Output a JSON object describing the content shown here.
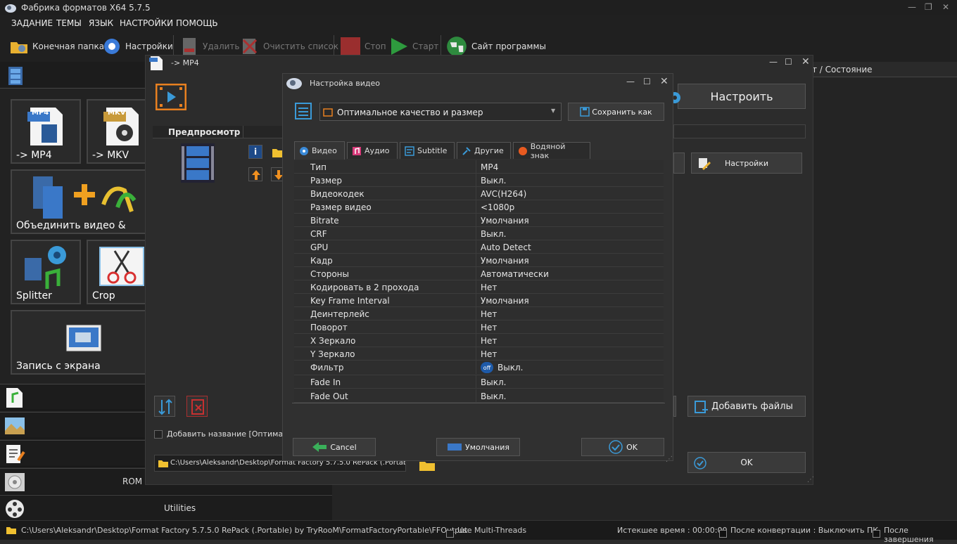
{
  "app": {
    "title": "Фабрика форматов X64 5.7.5"
  },
  "menu": [
    "ЗАДАНИЕ",
    "ТЕМЫ",
    "ЯЗЫК",
    "НАСТРОЙКИ",
    "ПОМОЩЬ"
  ],
  "toolbar": {
    "output_folder": "Конечная папка",
    "settings": "Настройки",
    "delete": "Удалить",
    "clear_list": "Очистить список",
    "stop": "Стоп",
    "start": "Старт",
    "website": "Сайт программы"
  },
  "left": {
    "tiles": {
      "mp4": "-> MP4",
      "mp4_badge": "MP4",
      "mkv": "-> MKV",
      "mkv_badge": "MKV",
      "join": "Объединить видео &",
      "splitter": "Splitter",
      "crop": "Crop",
      "record": "Запись с экрана"
    },
    "categories": {
      "rom": "ROM",
      "utilities": "Utilities"
    }
  },
  "main": {
    "status_col": "т / Состояние"
  },
  "convwin": {
    "title": "-> MP4",
    "preview": "Предпросмотр",
    "configure": "Настроить",
    "settings_btn": "Настройки",
    "add_files": "Добавить файлы",
    "add_name": "Добавить название [Оптимальное",
    "path": "C:\\Users\\Aleksandr\\Desktop\\Format Factory 5.7.5.0 RePack (.Portable) by TryRooM\\FormatFactoryPortable\\FFOutput",
    "ok": "OK"
  },
  "dialog": {
    "title": "Настройка видео",
    "profile": "Оптимальное качество и размер",
    "save_as": "Сохранить как",
    "tabs": [
      "Видео",
      "Аудио",
      "Subtitle",
      "Другие",
      "Водяной знак"
    ],
    "rows": [
      {
        "k": "Тип",
        "v": "MP4"
      },
      {
        "k": "Размер",
        "v": "Выкл."
      },
      {
        "k": "Видеокодек",
        "v": "AVC(H264)"
      },
      {
        "k": "Размер видео",
        "v": "<1080p"
      },
      {
        "k": "Bitrate",
        "v": "Умолчания"
      },
      {
        "k": "CRF",
        "v": "Выкл."
      },
      {
        "k": "GPU",
        "v": "Auto Detect"
      },
      {
        "k": "Кадр",
        "v": "Умолчания"
      },
      {
        "k": "Стороны",
        "v": "Автоматически"
      },
      {
        "k": "Кодировать в 2 прохода",
        "v": "Нет"
      },
      {
        "k": "Key Frame Interval",
        "v": "Умолчания"
      },
      {
        "k": "Деинтерлейс",
        "v": "Нет"
      },
      {
        "k": "Поворот",
        "v": "Нет"
      },
      {
        "k": "X Зеркало",
        "v": "Нет"
      },
      {
        "k": "Y Зеркало",
        "v": "Нет"
      },
      {
        "k": "Фильтр",
        "v": "Выкл.",
        "badge": "off"
      },
      {
        "k": "Fade In",
        "v": "Выкл."
      },
      {
        "k": "Fade Out",
        "v": "Выкл."
      }
    ],
    "cancel": "Cancel",
    "defaults": "Умолчания",
    "ok": "OK"
  },
  "status": {
    "path": "C:\\Users\\Aleksandr\\Desktop\\Format Factory 5.7.5.0 RePack (.Portable) by TryRooM\\FormatFactoryPortable\\FFOutput",
    "multithreads": "Use Multi-Threads",
    "elapsed": "Истекшее время : 00:00:00",
    "after_conv": "После конвертации : Выключить ПК",
    "after_done": "После завершения"
  }
}
